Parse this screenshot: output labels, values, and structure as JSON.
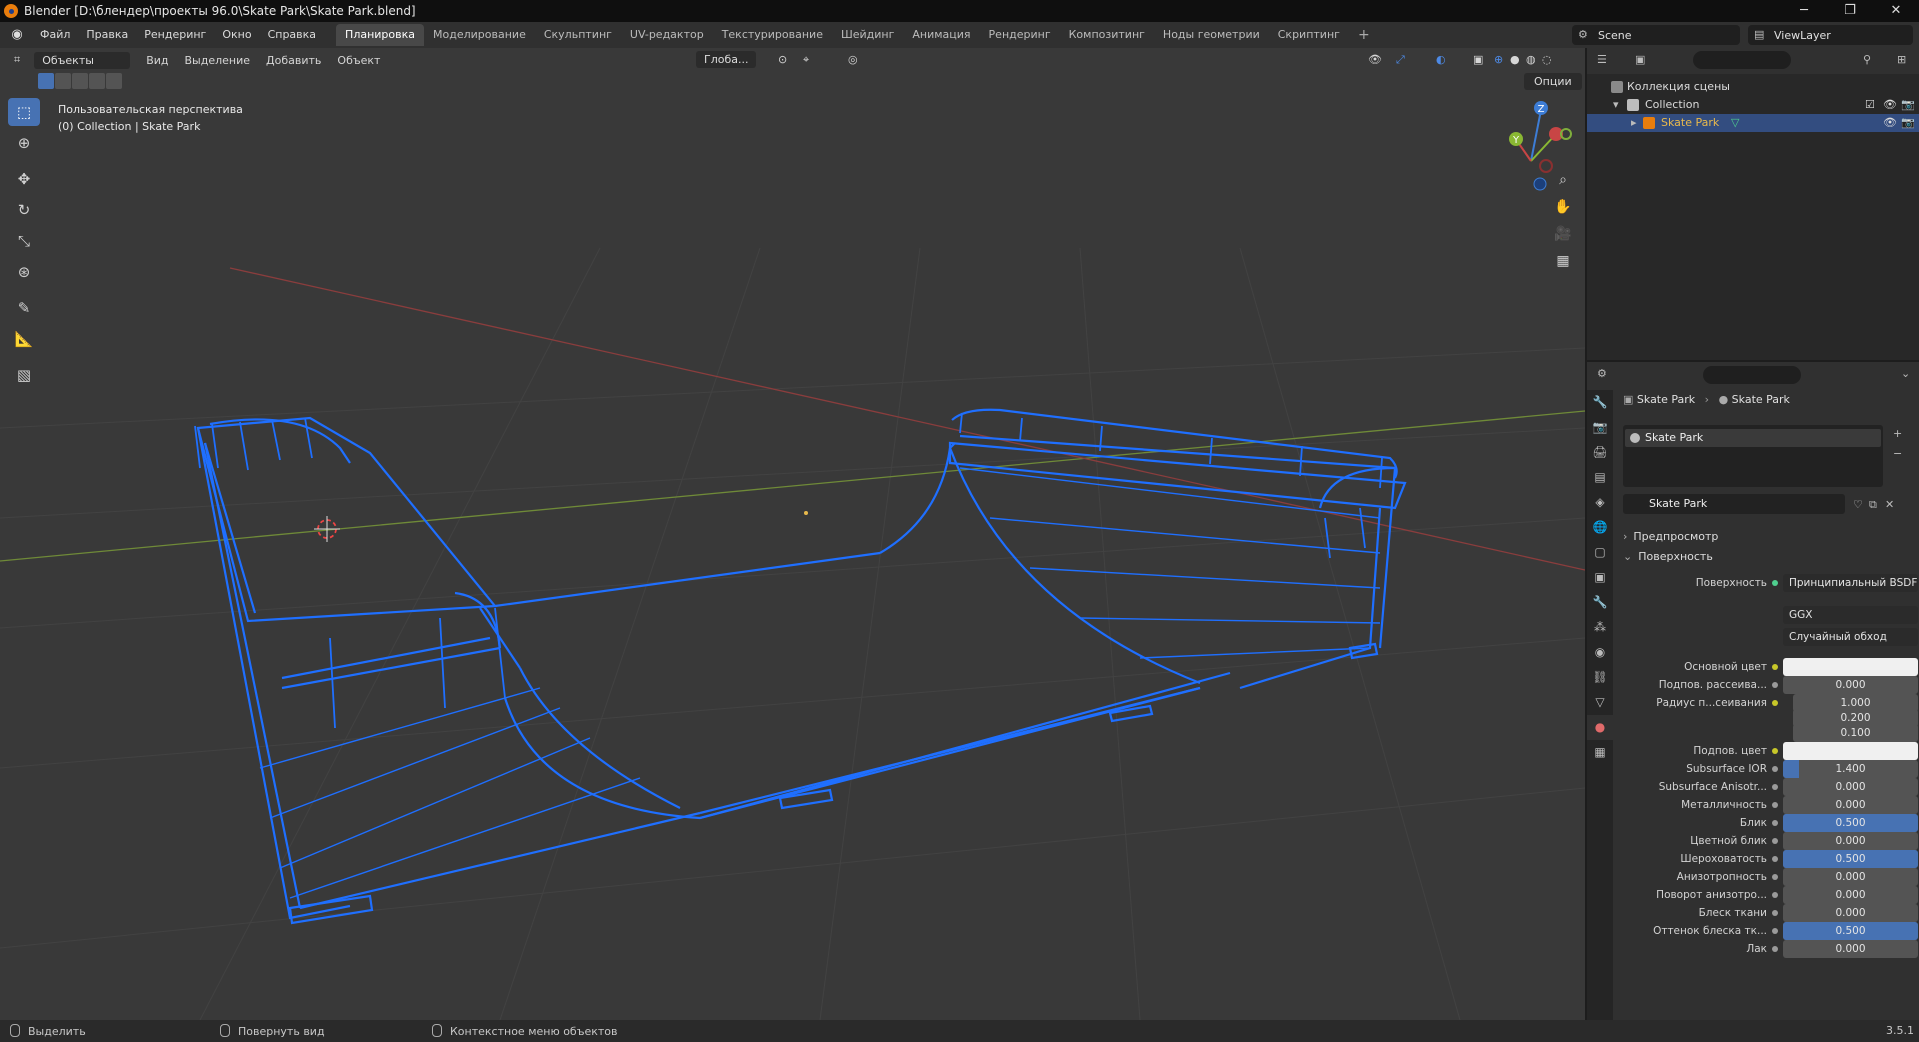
{
  "window": {
    "title": "Blender [D:\\блендер\\проекты 96.0\\Skate Park\\Skate Park.blend]"
  },
  "menu": {
    "items": [
      "Файл",
      "Правка",
      "Рендеринг",
      "Окно",
      "Справка"
    ]
  },
  "workspaces": {
    "items": [
      "Планировка",
      "Моделирование",
      "Скульптинг",
      "UV-редактор",
      "Текстурирование",
      "Шейдинг",
      "Анимация",
      "Рендеринг",
      "Композитинг",
      "Ноды геометрии",
      "Скриптинг"
    ],
    "active": "Планировка",
    "add": "+"
  },
  "scene": {
    "name": "Scene"
  },
  "view_layer": {
    "name": "ViewLayer"
  },
  "viewport": {
    "mode": "Объекты",
    "menus": [
      "Вид",
      "Выделение",
      "Добавить",
      "Объект"
    ],
    "transform_orientation": "Глоба...",
    "options_label": "Опции",
    "view_name": "Пользовательская перспектива",
    "collection_info": "(0) Collection | Skate Park",
    "axis_labels": {
      "x": "X",
      "y": "Y",
      "z": "Z"
    }
  },
  "outliner": {
    "root": "Коллекция сцены",
    "collection": "Collection",
    "object": "Skate Park"
  },
  "properties": {
    "breadcrumb_object": "Skate Park",
    "breadcrumb_material": "Skate Park",
    "slot_name": "Skate Park",
    "material_name": "Skate Park",
    "panel_preview": "Предпросмотр",
    "panel_surface": "Поверхность",
    "surface_label": "Поверхность",
    "surface_shader": "Принципиальный BSDF",
    "distribution": "GGX",
    "subsurface_method": "Случайный обход",
    "rows": [
      {
        "label": "Основной цвет",
        "value": "",
        "kind": "color"
      },
      {
        "label": "Подпов. рассеива...",
        "value": "0.000",
        "kind": "num",
        "fill": 0
      },
      {
        "label": "Радиус п...сеивания",
        "value": "1.000",
        "kind": "vec",
        "fill": 0
      },
      {
        "label": "",
        "value": "0.200",
        "kind": "vec",
        "fill": 0
      },
      {
        "label": "",
        "value": "0.100",
        "kind": "vec",
        "fill": 0
      },
      {
        "label": "Подпов. цвет",
        "value": "",
        "kind": "color"
      },
      {
        "label": "Subsurface IOR",
        "value": "1.400",
        "kind": "num",
        "fill": 0.12
      },
      {
        "label": "Subsurface Anisotr...",
        "value": "0.000",
        "kind": "num",
        "fill": 0
      },
      {
        "label": "Металличность",
        "value": "0.000",
        "kind": "num",
        "fill": 0
      },
      {
        "label": "Блик",
        "value": "0.500",
        "kind": "num",
        "fill": 1
      },
      {
        "label": "Цветной блик",
        "value": "0.000",
        "kind": "num",
        "fill": 0
      },
      {
        "label": "Шероховатость",
        "value": "0.500",
        "kind": "num",
        "fill": 1
      },
      {
        "label": "Анизотропность",
        "value": "0.000",
        "kind": "num",
        "fill": 0
      },
      {
        "label": "Поворот анизотро...",
        "value": "0.000",
        "kind": "num",
        "fill": 0
      },
      {
        "label": "Блеск ткани",
        "value": "0.000",
        "kind": "num",
        "fill": 0
      },
      {
        "label": "Оттенок блеска тк...",
        "value": "0.500",
        "kind": "num",
        "fill": 1
      },
      {
        "label": "Лак",
        "value": "0.000",
        "kind": "num",
        "fill": 0
      }
    ]
  },
  "statusbar": {
    "select": "Выделить",
    "rotate": "Повернуть вид",
    "context_menu": "Контекстное меню объектов",
    "version": "3.5.1"
  },
  "colors": {
    "accent": "#4772b3",
    "wireframe": "#1f6fff",
    "selected_text": "#e8b94c",
    "background": "#393939"
  }
}
